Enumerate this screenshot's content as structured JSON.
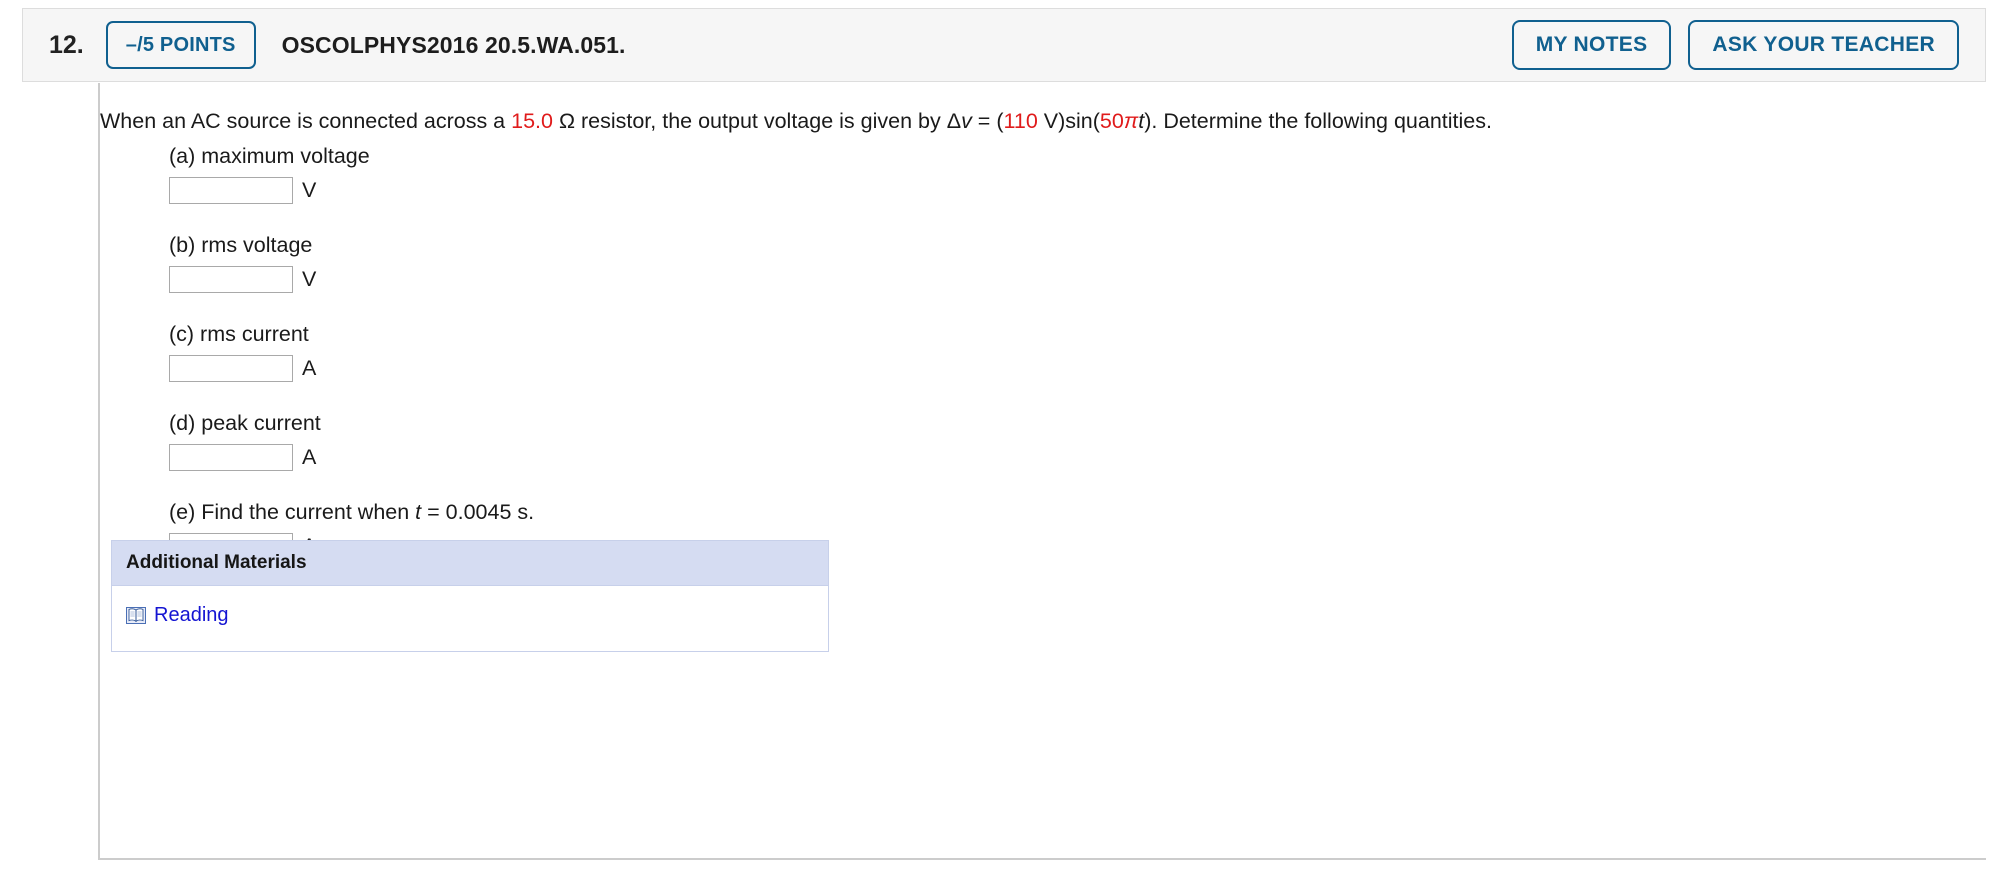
{
  "header": {
    "question_number": "12.",
    "points_label": "–/5 POINTS",
    "question_code": "OSCOLPHYS2016 20.5.WA.051.",
    "my_notes_label": "MY NOTES",
    "ask_teacher_label": "ASK YOUR TEACHER",
    "accent_color": "#10608f",
    "background_color": "#f6f6f6"
  },
  "prompt": {
    "s1": "When an AC source is connected across a ",
    "v1": "15.0",
    "s2": " Ω resistor, the output voltage is given by ",
    "delta": "Δ",
    "v_sym": "v",
    "s3": " = (",
    "v2": "110",
    "s4": " V)sin(",
    "v3": "50",
    "pi_sym": "π",
    "t_sym": "t",
    "s5": "). Determine the following quantities.",
    "highlight_color": "#e01b1b"
  },
  "parts": [
    {
      "label": "(a) maximum voltage",
      "value": "",
      "unit": "V"
    },
    {
      "label": "(b) rms voltage",
      "value": "",
      "unit": "V"
    },
    {
      "label": "(c) rms current",
      "value": "",
      "unit": "A"
    },
    {
      "label": "(d) peak current",
      "value": "",
      "unit": "A"
    }
  ],
  "part_e": {
    "prefix": "(e) Find the current when ",
    "var": "t",
    "suffix": " = 0.0045 s.",
    "value": "",
    "unit": "A"
  },
  "additional_materials": {
    "title": "Additional Materials",
    "header_color": "#d5dcf2",
    "items": [
      {
        "icon": "book-icon",
        "label": "Reading",
        "link_color": "#1414d2"
      }
    ]
  }
}
